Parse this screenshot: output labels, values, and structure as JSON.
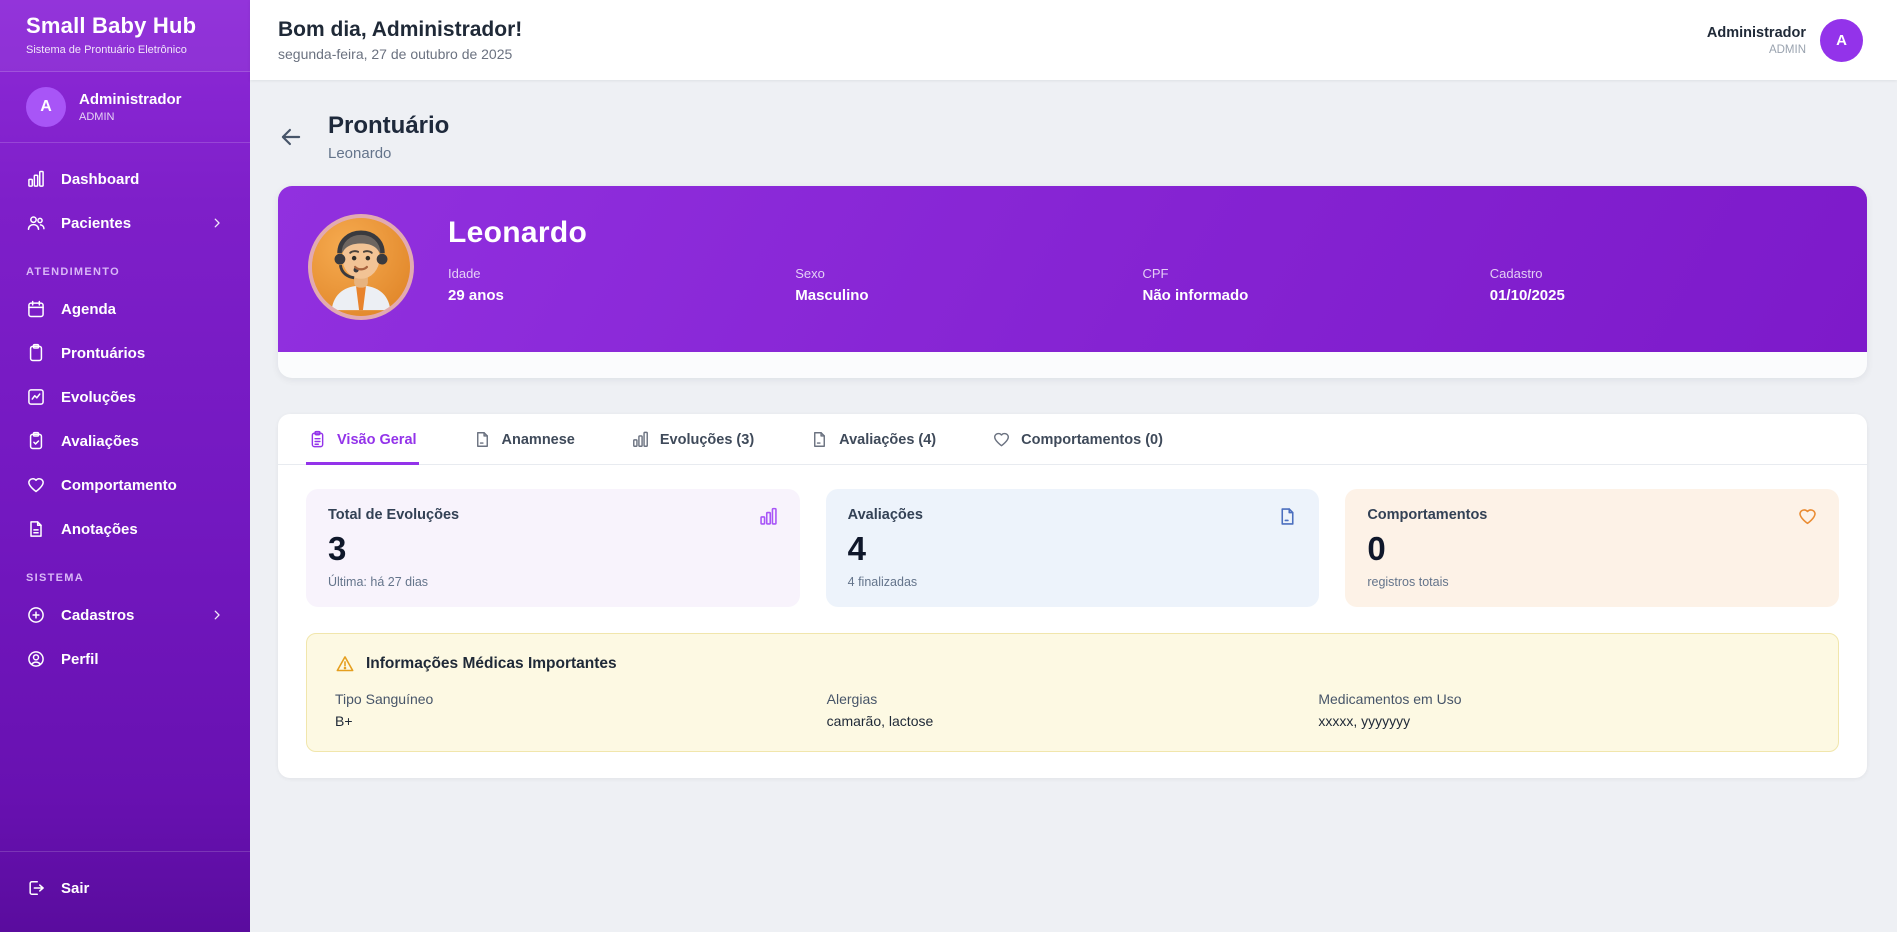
{
  "colors": {
    "accent": "#9333ea",
    "sidebar_gradient_top": "#8e2ad8",
    "sidebar_gradient_bottom": "#5a0c9e",
    "banner_purple": "#8523d2",
    "stat_evolucoes_bg": "#f8f3fc",
    "stat_evolucoes_icon": "#a855f7",
    "stat_avaliacoes_bg": "#edf3fb",
    "stat_avaliacoes_icon": "#4c6fbf",
    "stat_comportamentos_bg": "#fdf2e7",
    "stat_comportamentos_icon": "#ea8c33",
    "medical_bg": "#fdf9e3",
    "medical_border": "#f1e6ac",
    "warning_icon": "#e59f1f"
  },
  "brand": {
    "title": "Small Baby Hub",
    "subtitle": "Sistema de Prontuário Eletrônico"
  },
  "sidebar": {
    "user": {
      "name": "Administrador",
      "role": "ADMIN",
      "initial": "A"
    },
    "section_atendimento": "ATENDIMENTO",
    "section_sistema": "SISTEMA",
    "nav": [
      {
        "label": "Dashboard"
      },
      {
        "label": "Pacientes"
      },
      {
        "label": "Agenda"
      },
      {
        "label": "Prontuários"
      },
      {
        "label": "Evoluções"
      },
      {
        "label": "Avaliações"
      },
      {
        "label": "Comportamento"
      },
      {
        "label": "Anotações"
      },
      {
        "label": "Cadastros"
      },
      {
        "label": "Perfil"
      }
    ],
    "logout_label": "Sair"
  },
  "topbar": {
    "greeting": "Bom dia, Administrador!",
    "date": "segunda-feira, 27 de outubro de 2025",
    "user": {
      "name": "Administrador",
      "role": "ADMIN",
      "initial": "A"
    }
  },
  "page": {
    "title": "Prontuário",
    "subtitle": "Leonardo"
  },
  "patient": {
    "name": "Leonardo",
    "fields": [
      {
        "label": "Idade",
        "value": "29 anos"
      },
      {
        "label": "Sexo",
        "value": "Masculino"
      },
      {
        "label": "CPF",
        "value": "Não informado"
      },
      {
        "label": "Cadastro",
        "value": "01/10/2025"
      }
    ]
  },
  "tabs": [
    {
      "label": "Visão Geral",
      "active": true
    },
    {
      "label": "Anamnese",
      "active": false
    },
    {
      "label": "Evoluções (3)",
      "active": false
    },
    {
      "label": "Avaliações (4)",
      "active": false
    },
    {
      "label": "Comportamentos (0)",
      "active": false
    }
  ],
  "stats": [
    {
      "title": "Total de Evoluções",
      "value": "3",
      "subtitle": "Última: há 27 dias"
    },
    {
      "title": "Avaliações",
      "value": "4",
      "subtitle": "4 finalizadas"
    },
    {
      "title": "Comportamentos",
      "value": "0",
      "subtitle": "registros totais"
    }
  ],
  "medical": {
    "title": "Informações Médicas Importantes",
    "fields": [
      {
        "label": "Tipo Sanguíneo",
        "value": "B+"
      },
      {
        "label": "Alergias",
        "value": "camarão, lactose"
      },
      {
        "label": "Medicamentos em Uso",
        "value": "xxxxx, yyyyyyy"
      }
    ]
  }
}
